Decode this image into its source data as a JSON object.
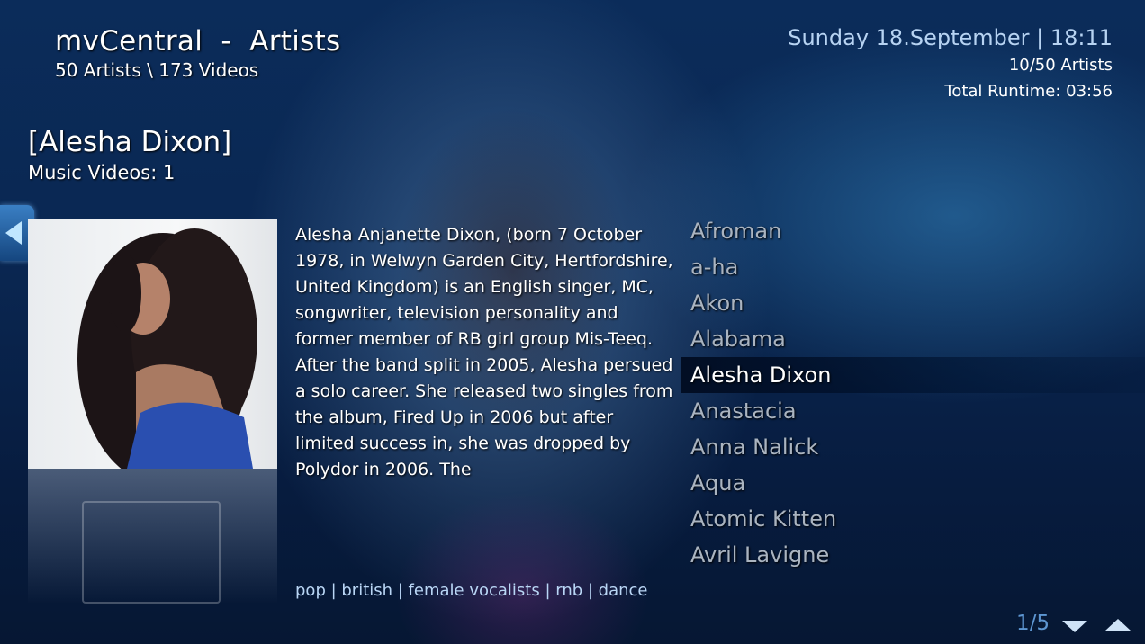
{
  "header": {
    "title": "mvCentral  -  Artists",
    "subtitle": "50 Artists \\ 173 Videos",
    "date_time": "Sunday 18.September | 18:11",
    "artist_position": "10/50 Artists",
    "total_runtime": "Total Runtime: 03:56"
  },
  "artist": {
    "name": "[Alesha Dixon]",
    "video_count": "Music Videos: 1",
    "bio": "Alesha Anjanette Dixon, (born 7 October 1978, in Welwyn Garden City, Hertfordshire, United Kingdom) is an English singer, MC, songwriter, television personality and former member of RB girl group Mis-Teeq. After the band split in 2005, Alesha persued a solo career. She released two singles from the album, Fired Up in 2006 but after limited success in, she was dropped by Polydor in 2006. The",
    "tags": "pop | british | female vocalists | rnb | dance"
  },
  "artist_list": [
    {
      "name": "Afroman"
    },
    {
      "name": "a-ha"
    },
    {
      "name": "Akon"
    },
    {
      "name": "Alabama"
    },
    {
      "name": "Alesha Dixon",
      "selected": true
    },
    {
      "name": "Anastacia"
    },
    {
      "name": "Anna Nalick"
    },
    {
      "name": "Aqua"
    },
    {
      "name": "Atomic Kitten"
    },
    {
      "name": "Avril Lavigne"
    }
  ],
  "pagination": {
    "page": "1/5"
  },
  "icons": {
    "back": "left-arrow-icon",
    "page_down": "chevron-down-icon",
    "page_up": "chevron-up-icon"
  },
  "colors": {
    "accent": "#5d96d2",
    "date_text": "#b7d3f2",
    "tags_text": "#b9d6f5",
    "list_inactive": "#aab4c0"
  }
}
